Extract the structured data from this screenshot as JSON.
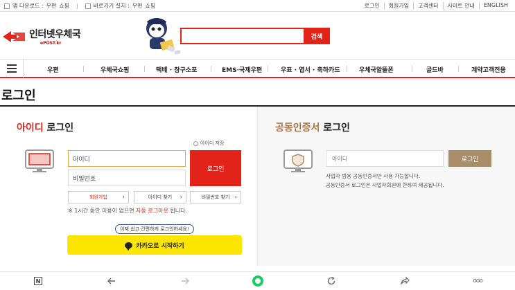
{
  "topbar": {
    "app_download_label": "앱 다운로드 :",
    "app_download_items": [
      "우편",
      "쇼핑"
    ],
    "shortcut_label": "바로가기 설치 :",
    "shortcut_items": [
      "우편",
      "쇼핑"
    ],
    "right_links": [
      "로그인",
      "회원가입",
      "고객센터",
      "사이트 안내",
      "ENGLISH"
    ]
  },
  "header": {
    "logo_ko": "인터넷우체국",
    "logo_en": "ePOST.kr",
    "search_placeholder": "",
    "search_button": "검색"
  },
  "nav": {
    "items": [
      "우편",
      "우체국쇼핑",
      "택배 · 창구소포",
      "EMS·국제우편",
      "우표 · 엽서 · 축하카드",
      "우체국알뜰폰",
      "골드바",
      "계약고객전용"
    ]
  },
  "page": {
    "title": "로그인"
  },
  "id_login": {
    "title_accent": "아이디",
    "title_rest": " 로그인",
    "keep_login": "아이디 저장",
    "id_placeholder": "아이디",
    "pw_placeholder": "비밀번호",
    "login_button": "로그인",
    "signup_button": "회원가입",
    "find_id_button": "아이디 찾기",
    "find_pw_button": "비밀번호 찾기",
    "note_prefix": "※ 1시간 동안 이용이 없으면 ",
    "note_emphasis": "자동 로그아웃",
    "note_suffix": " 됩니다.",
    "kakao_bubble": "이제 쉽고 간편하게 로그인하세요!",
    "kakao_button": "카카오로 시작하기"
  },
  "cert_login": {
    "title_accent": "공동인증서",
    "title_rest": " 로그인",
    "id_placeholder": "아이디",
    "login_button": "로그인",
    "desc1": "사업자 범용 공동인증서만 사용 가능합니다.",
    "desc2": "공동인증서 로그인은 사업자회원에 한하여 제공됩니다."
  },
  "bottombar": {
    "icons": [
      "naver-n-icon",
      "back-arrow-icon",
      "forward-arrow-icon",
      "green-circle-icon",
      "refresh-icon",
      "share-icon",
      "more-icon"
    ],
    "n_label": "N",
    "more_label": "ooo"
  },
  "colors": {
    "brand_red": "#e2231a",
    "cert_tan": "#a88d68",
    "kakao_yellow": "#fee500"
  }
}
